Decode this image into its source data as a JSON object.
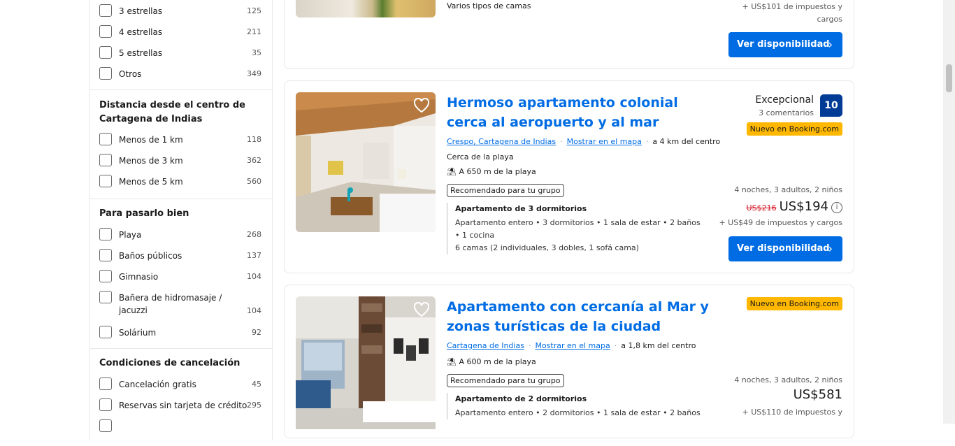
{
  "filters": {
    "stars": [
      {
        "label": "3 estrellas",
        "count": "125"
      },
      {
        "label": "4 estrellas",
        "count": "211"
      },
      {
        "label": "5 estrellas",
        "count": "35"
      },
      {
        "label": "Otros",
        "count": "349"
      }
    ],
    "distance": {
      "title": "Distancia desde el centro de Cartagena de Indias",
      "items": [
        {
          "label": "Menos de 1 km",
          "count": "118"
        },
        {
          "label": "Menos de 3 km",
          "count": "362"
        },
        {
          "label": "Menos de 5 km",
          "count": "560"
        }
      ]
    },
    "fun": {
      "title": "Para pasarlo bien",
      "items": [
        {
          "label": "Playa",
          "count": "268"
        },
        {
          "label": "Baños públicos",
          "count": "137"
        },
        {
          "label": "Gimnasio",
          "count": "104"
        },
        {
          "label": "Bañera de hidromasaje / jacuzzi",
          "count": "104"
        },
        {
          "label": "Solárium",
          "count": "92"
        }
      ]
    },
    "cancel": {
      "title": "Condiciones de cancelación",
      "items": [
        {
          "label": "Cancelación gratis",
          "count": "45"
        },
        {
          "label": "Reservas sin tarjeta de crédito",
          "count": "295"
        }
      ]
    }
  },
  "cards": [
    {
      "beds": "Varios tipos de camas",
      "taxes": "+ US$101 de impuestos y cargos",
      "button": "Ver disponibilidad"
    },
    {
      "title": "Hermoso apartamento colonial cerca al aeropuerto y al mar",
      "location": "Crespo, Cartagena de Indias",
      "map_link": "Mostrar en el mapa",
      "distance": "a 4 km del centro",
      "near": "Cerca de la playa",
      "beach": "A 650 m de la playa",
      "tag": "Recomendado para tu grupo",
      "unit_title": "Apartamento de 3 dormitorios",
      "unit_lines": [
        "Apartamento entero • 3 dormitorios • 1 sala de estar • 2 baños",
        "• 1 cocina",
        "6 camas (2 individuales, 3 dobles, 1 sofá cama)"
      ],
      "score_word": "Excepcional",
      "score_count": "3 comentarios",
      "score": "10",
      "new_badge": "Nuevo en Booking.com",
      "stay": "4 noches, 3 adultos, 2 niños",
      "old_price": "US$216",
      "price": "US$194",
      "taxes": "+ US$49 de impuestos y cargos",
      "button": "Ver disponibilidad"
    },
    {
      "title": "Apartamento con cercanía al Mar y zonas turísticas de la ciudad",
      "location": "Cartagena de Indias",
      "map_link": "Mostrar en el mapa",
      "distance": "a 1,8 km del centro",
      "beach": "A 600 m de la playa",
      "tag": "Recomendado para tu grupo",
      "unit_title": "Apartamento de 2 dormitorios",
      "unit_lines": [
        "Apartamento entero • 2 dormitorios • 1 sala de estar • 2 baños"
      ],
      "new_badge": "Nuevo en Booking.com",
      "stay": "4 noches, 3 adultos, 2 niños",
      "price": "US$581",
      "taxes": "+ US$110 de impuestos y"
    }
  ]
}
